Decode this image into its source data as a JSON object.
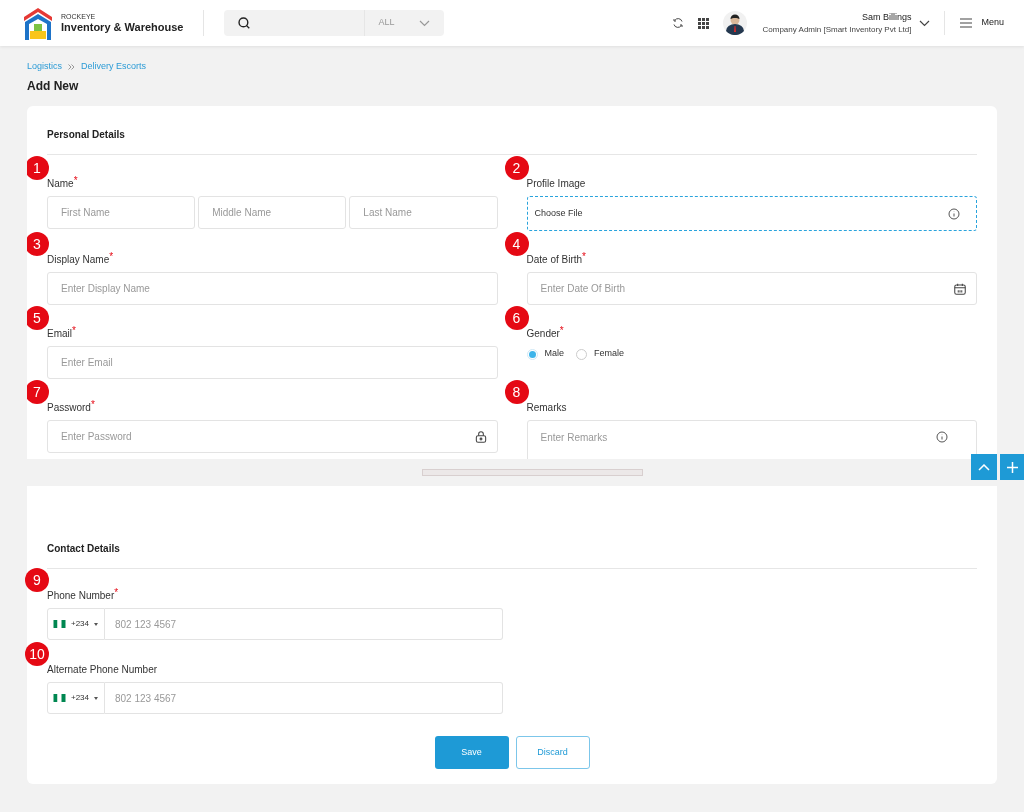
{
  "header": {
    "brand_small": "ROCKEYE",
    "brand": "Inventory & Warehouse",
    "search_filter": "ALL",
    "user_name": "Sam Billings",
    "user_role": "Company Admin [Smart Inventory Pvt Ltd]",
    "menu_label": "Menu"
  },
  "breadcrumb": [
    "Logistics",
    "Delivery Escorts"
  ],
  "page_title": "Add New",
  "required_mark": "*",
  "personal": {
    "title": "Personal Details",
    "fields": [
      {
        "marker": "1",
        "label": "Name",
        "required": true,
        "kind": "name",
        "placeholders": [
          "First Name",
          "Middle Name",
          "Last Name"
        ]
      },
      {
        "marker": "2",
        "label": "Profile Image",
        "required": false,
        "kind": "file",
        "value": "Choose File"
      },
      {
        "marker": "3",
        "label": "Display Name",
        "required": true,
        "kind": "text",
        "placeholder": "Enter Display Name"
      },
      {
        "marker": "4",
        "label": "Date of Birth",
        "required": true,
        "kind": "date",
        "placeholder": "Enter Date Of Birth"
      },
      {
        "marker": "5",
        "label": "Email",
        "required": true,
        "kind": "text",
        "placeholder": "Enter Email"
      },
      {
        "marker": "6",
        "label": "Gender",
        "required": true,
        "kind": "radio",
        "options": [
          {
            "label": "Male",
            "selected": true
          },
          {
            "label": "Female",
            "selected": false
          }
        ]
      },
      {
        "marker": "7",
        "label": "Password",
        "required": true,
        "kind": "password",
        "placeholder": "Enter Password"
      },
      {
        "marker": "8",
        "label": "Remarks",
        "required": false,
        "kind": "textarea",
        "placeholder": "Enter Remarks"
      }
    ]
  },
  "contact": {
    "title": "Contact Details",
    "fields": [
      {
        "marker": "9",
        "label": "Phone Number",
        "required": true,
        "dial_code": "+234",
        "placeholder": "802 123 4567"
      },
      {
        "marker": "10",
        "label": "Alternate Phone Number",
        "required": false,
        "dial_code": "+234",
        "placeholder": "802 123 4567"
      }
    ]
  },
  "buttons": [
    {
      "label": "Save",
      "kind": "primary"
    },
    {
      "label": "Discard",
      "kind": "secondary"
    }
  ]
}
